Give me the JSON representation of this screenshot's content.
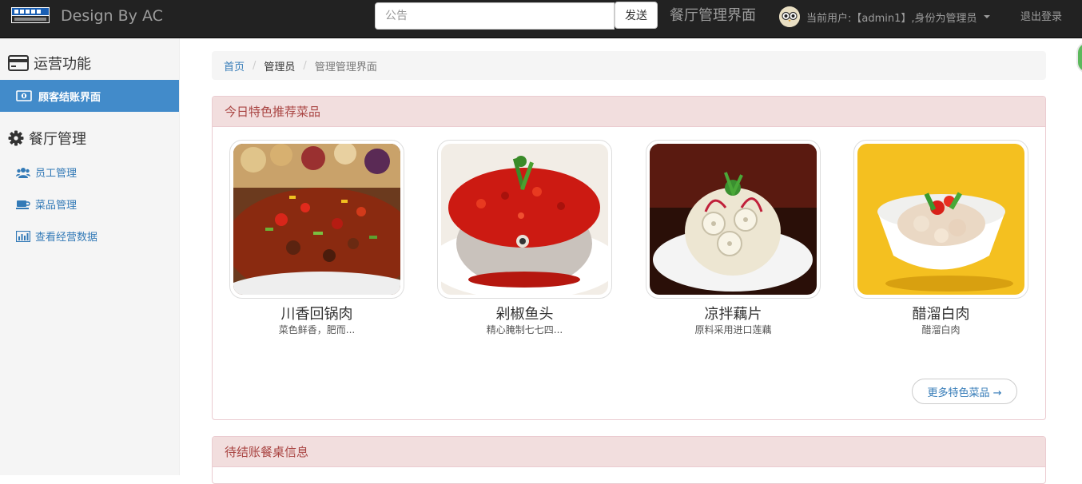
{
  "navbar": {
    "brand_text": "Design By AC",
    "search_placeholder": "公告",
    "send_label": "发送",
    "title": "餐厅管理界面",
    "user_label": "当前用户:【admin1】,身份为管理员",
    "logout_label": "退出登录"
  },
  "sidebar": {
    "section1": {
      "title": "运营功能",
      "icon": "credit-card-icon"
    },
    "active_item": {
      "label": "顾客结账界面",
      "icon": "money-icon"
    },
    "section2": {
      "title": "餐厅管理",
      "icon": "gear-icon"
    },
    "items": [
      {
        "label": "员工管理",
        "icon": "users-icon"
      },
      {
        "label": "菜品管理",
        "icon": "cup-icon"
      },
      {
        "label": "查看经营数据",
        "icon": "bar-chart-icon"
      }
    ]
  },
  "breadcrumb": {
    "home": "首页",
    "middle": "管理员",
    "current": "管理管理界面"
  },
  "featured": {
    "heading": "今日特色推荐菜品",
    "dishes": [
      {
        "name": "川香回锅肉",
        "desc": "菜色鲜香，肥而..."
      },
      {
        "name": "剁椒鱼头",
        "desc": "精心腌制七七四..."
      },
      {
        "name": "凉拌藕片",
        "desc": "原料采用进口莲藕"
      },
      {
        "name": "醋溜白肉",
        "desc": "醋溜白肉"
      }
    ],
    "more_label": "更多特色菜品 →"
  },
  "pending": {
    "heading": "待结账餐桌信息"
  },
  "colors": {
    "navbar_bg": "#222222",
    "active_item_bg": "#428bca",
    "panel_heading_bg": "#f2dede",
    "panel_heading_text": "#a94442",
    "link": "#337ab7"
  }
}
